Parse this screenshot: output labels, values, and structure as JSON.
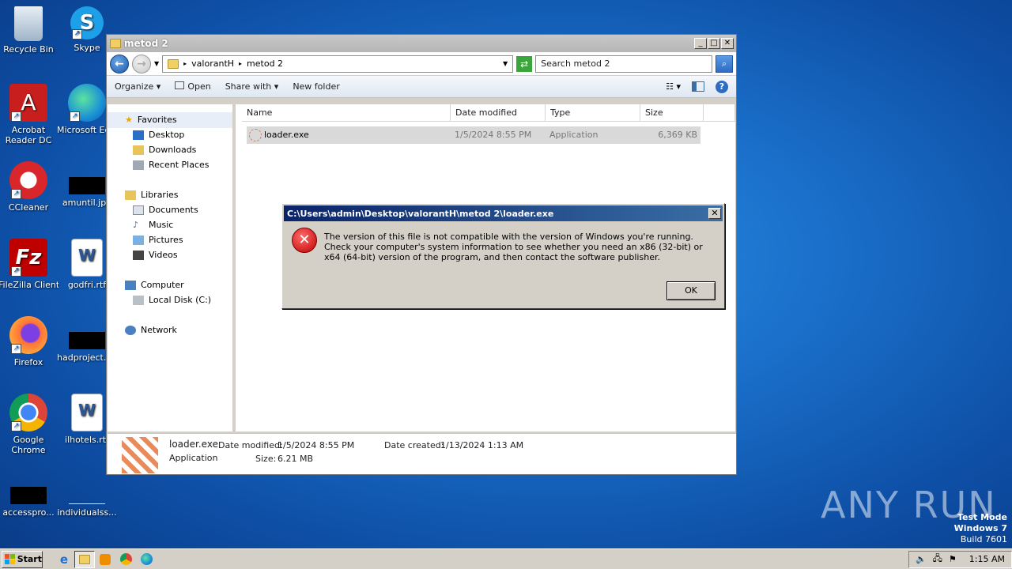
{
  "desktop": {
    "icons": [
      {
        "label": "Recycle Bin"
      },
      {
        "label": "Skype"
      },
      {
        "label": "Acrobat Reader DC"
      },
      {
        "label": "Microsoft Edge"
      },
      {
        "label": "CCleaner"
      },
      {
        "label": "amuntil.jpg"
      },
      {
        "label": "FileZilla Client"
      },
      {
        "label": "godfri.rtf"
      },
      {
        "label": "Firefox"
      },
      {
        "label": "hadproject.png"
      },
      {
        "label": "Google Chrome"
      },
      {
        "label": "ilhotels.rtf"
      },
      {
        "label": "accesspro..."
      },
      {
        "label": "individualss..."
      }
    ]
  },
  "explorer": {
    "title": "metod 2",
    "breadcrumb": [
      "valorantH",
      "metod 2"
    ],
    "search_placeholder": "Search metod 2",
    "toolbar": {
      "organize": "Organize",
      "open": "Open",
      "share_with": "Share with",
      "new_folder": "New folder"
    },
    "nav": {
      "favorites": "Favorites",
      "desktop": "Desktop",
      "downloads": "Downloads",
      "recent_places": "Recent Places",
      "libraries": "Libraries",
      "documents": "Documents",
      "music": "Music",
      "pictures": "Pictures",
      "videos": "Videos",
      "computer": "Computer",
      "local_disk": "Local Disk (C:)",
      "network": "Network"
    },
    "columns": {
      "name": "Name",
      "date_modified": "Date modified",
      "type": "Type",
      "size": "Size"
    },
    "files": [
      {
        "name": "loader.exe",
        "date_modified": "1/5/2024 8:55 PM",
        "type": "Application",
        "size": "6,369 KB"
      }
    ],
    "details": {
      "name": "loader.exe",
      "type": "Application",
      "date_modified_label": "Date modified:",
      "date_modified": "1/5/2024 8:55 PM",
      "size_label": "Size:",
      "size": "6.21 MB",
      "date_created_label": "Date created:",
      "date_created": "1/13/2024 1:13 AM"
    }
  },
  "dialog": {
    "title": "C:\\Users\\admin\\Desktop\\valorantH\\metod 2\\loader.exe",
    "message": "The version of this file is not compatible with the version of Windows you're running. Check your computer's system information to see whether you need an x86 (32-bit) or x64 (64-bit) version of the program, and then contact the software publisher.",
    "ok": "OK"
  },
  "watermark": {
    "text": "ANY RUN"
  },
  "system": {
    "test_mode": "Test Mode",
    "os": "Windows 7",
    "build": "Build 7601"
  },
  "taskbar": {
    "start": "Start",
    "clock": "1:15 AM"
  },
  "colors": {
    "title_active": "#0a246a",
    "error_red": "#c00000",
    "selection": "#d9d9d9"
  }
}
